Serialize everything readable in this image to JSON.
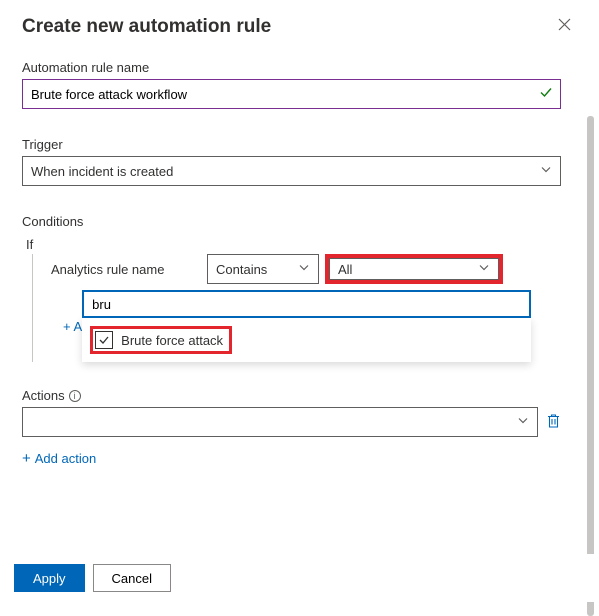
{
  "header": {
    "title": "Create new automation rule"
  },
  "rule_name": {
    "label": "Automation rule name",
    "value": "Brute force attack workflow"
  },
  "trigger": {
    "label": "Trigger",
    "value": "When incident is created"
  },
  "conditions": {
    "label": "Conditions",
    "if_label": "If",
    "field_label": "Analytics rule name",
    "operator": "Contains",
    "value_selector": "All",
    "search_value": "bru",
    "option_label": "Brute force attack",
    "option_checked": true,
    "add_label": "+ A"
  },
  "actions": {
    "label": "Actions",
    "selected": "",
    "add_label": "Add action"
  },
  "footer": {
    "apply": "Apply",
    "cancel": "Cancel"
  }
}
